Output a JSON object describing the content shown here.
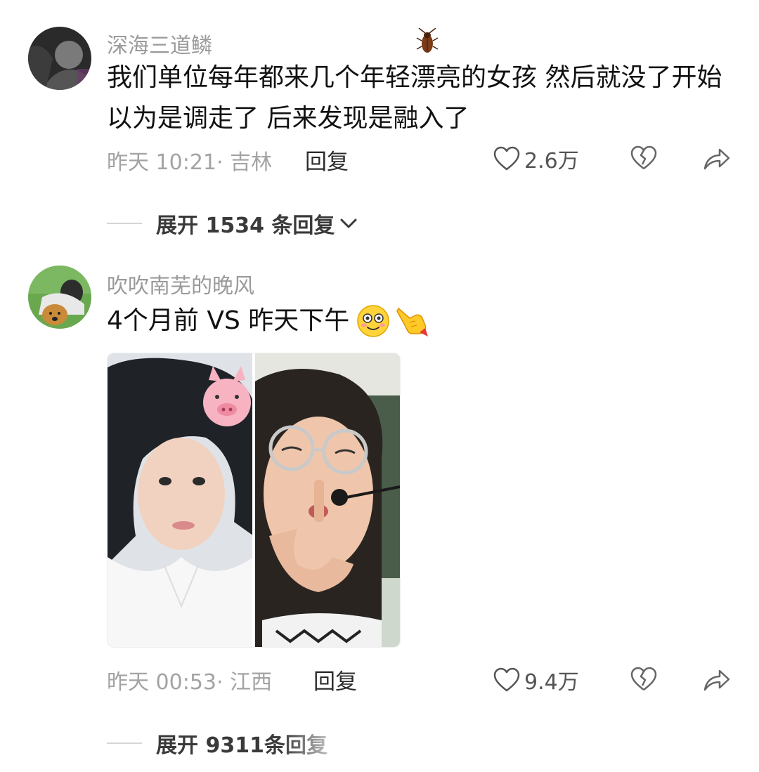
{
  "comments": [
    {
      "username": "深海三道鳞",
      "text": "我们单位每年都来几个年轻漂亮的女孩  然后就没了开始以为是调走了  后来发现是融入了",
      "meta": "昨天 10:21· 吉林",
      "reply_label": "回复",
      "likes": "2.6万",
      "expand_label": "展开 1534 条回复",
      "badge_icon": "cockroach-icon"
    },
    {
      "username": "吹吹南芜的晚风",
      "text": "4个月前 VS 昨天下午",
      "meta": "昨天 00:53· 江西",
      "reply_label": "回复",
      "likes": "9.4万",
      "expand_label": "展开 9311条回复",
      "emojis": [
        "smiley-dizzy-icon",
        "pointing-hand-icon"
      ]
    }
  ],
  "icons": {
    "like": "heart-outline-icon",
    "dislike": "broken-heart-icon",
    "share": "share-arrow-icon",
    "expand": "chevron-down-icon"
  },
  "colors": {
    "username": "#9a9a9a",
    "meta": "#a3a3a3",
    "text": "#111111"
  }
}
